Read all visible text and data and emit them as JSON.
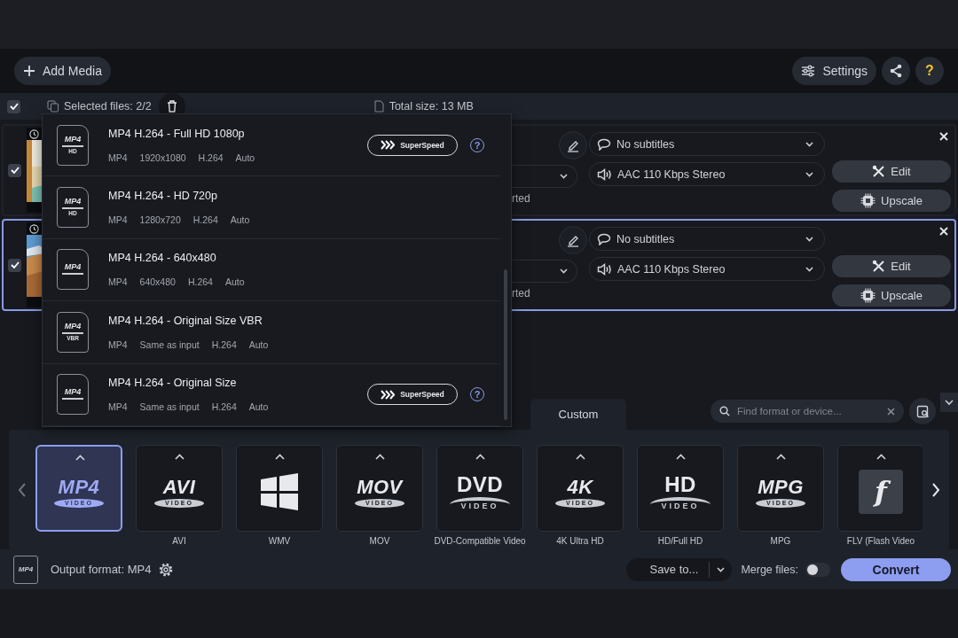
{
  "toolbar": {
    "add_media": "Add Media",
    "settings": "Settings",
    "help": "?"
  },
  "selection": {
    "checked": true,
    "label": "Selected files: 2/2",
    "total": "Total size: 13 MB"
  },
  "files": [
    {
      "checked": true,
      "selected": false,
      "subtitles": "No subtitles",
      "audio": "AAC 110 Kbps Stereo",
      "status": "rted",
      "edit": "Edit",
      "upscale": "Upscale"
    },
    {
      "checked": true,
      "selected": true,
      "subtitles": "No subtitles",
      "audio": "AAC 110 Kbps Stereo",
      "status": "rted",
      "edit": "Edit",
      "upscale": "Upscale"
    }
  ],
  "presets": [
    {
      "icon_text": "MP4",
      "icon_badge": "HD",
      "title": "MP4 H.264 - Full HD 1080p",
      "specs": [
        "MP4",
        "1920x1080",
        "H.264",
        "Auto"
      ],
      "superspeed": "SuperSpeed",
      "help": "?"
    },
    {
      "icon_text": "MP4",
      "icon_badge": "HD",
      "title": "MP4 H.264 - HD 720p",
      "specs": [
        "MP4",
        "1280x720",
        "H.264",
        "Auto"
      ]
    },
    {
      "icon_text": "MP4",
      "title": "MP4 H.264 - 640x480",
      "specs": [
        "MP4",
        "640x480",
        "H.264",
        "Auto"
      ]
    },
    {
      "icon_text": "MP4",
      "icon_badge": "VBR",
      "title": "MP4 H.264 - Original Size VBR",
      "specs": [
        "MP4",
        "Same as input",
        "H.264",
        "Auto"
      ]
    },
    {
      "icon_text": "MP4",
      "title": "MP4 H.264 - Original Size",
      "specs": [
        "MP4",
        "Same as input",
        "H.264",
        "Auto"
      ],
      "superspeed": "SuperSpeed",
      "help": "?"
    }
  ],
  "format_tabs": [
    {
      "label": "Custom",
      "selected": false
    }
  ],
  "search": {
    "placeholder": "Find format or device..."
  },
  "formats": [
    {
      "kind": "logo",
      "logo": "MP4",
      "sub": "VIDEO",
      "selected": true
    },
    {
      "kind": "logo",
      "logo": "AVI",
      "sub": "VIDEO",
      "label": "AVI",
      "selected": false
    },
    {
      "kind": "windows",
      "label": "WMV",
      "selected": false
    },
    {
      "kind": "logo",
      "logo": "MOV",
      "sub": "VIDEO",
      "label": "MOV",
      "selected": false
    },
    {
      "kind": "disc",
      "logo": "DVD",
      "sub": "VIDEO",
      "label": "DVD-Compatible Video",
      "selected": false
    },
    {
      "kind": "logo",
      "logo": "4K",
      "sub": "VIDEO",
      "label": "4K Ultra HD",
      "selected": false
    },
    {
      "kind": "disc",
      "logo": "HD",
      "sub": "VIDEO",
      "label": "HD/Full HD",
      "selected": false
    },
    {
      "kind": "logo",
      "logo": "MPG",
      "sub": "VIDEO",
      "label": "MPG",
      "selected": false
    },
    {
      "kind": "flash",
      "logo": "f",
      "label": "FLV (Flash Video",
      "selected": false
    }
  ],
  "bottom": {
    "icon_text": "MP4",
    "output_format": "Output format: MP4",
    "save_to": "Save to...",
    "merge_label": "Merge files:",
    "merge_on": false,
    "convert": "Convert"
  }
}
